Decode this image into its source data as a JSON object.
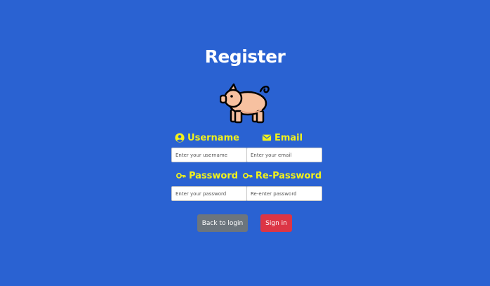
{
  "page": {
    "title": "Register",
    "background_color": "#2a62d2",
    "accent_color": "#f2f21a"
  },
  "logo": {
    "icon": "pig-icon"
  },
  "form": {
    "username": {
      "label": "Username",
      "icon": "user-circle-icon",
      "placeholder": "Enter your username",
      "value": ""
    },
    "email": {
      "label": "Email",
      "icon": "envelope-icon",
      "placeholder": "Enter your email",
      "value": ""
    },
    "password": {
      "label": "Password",
      "icon": "key-icon",
      "placeholder": "Enter your password",
      "value": ""
    },
    "repassword": {
      "label": "Re-Password",
      "icon": "key-icon",
      "placeholder": "Re-enter password",
      "value": ""
    }
  },
  "buttons": {
    "back": {
      "label": "Back to login",
      "color": "#6c757d"
    },
    "signin": {
      "label": "Sign in",
      "color": "#dc3545"
    }
  }
}
